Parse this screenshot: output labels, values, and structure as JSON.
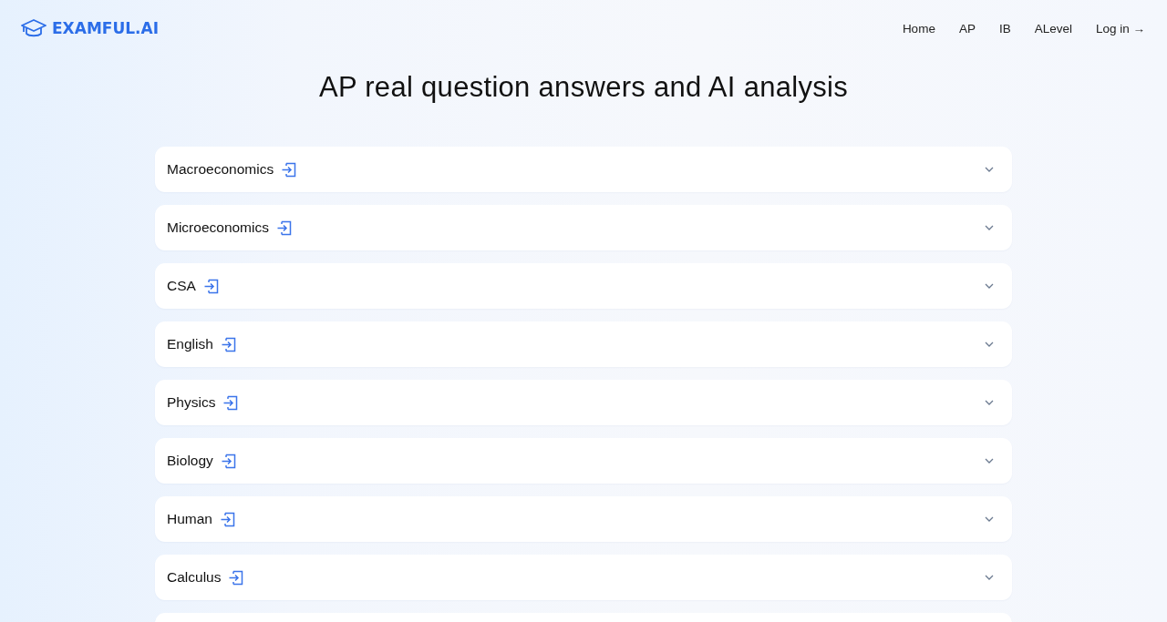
{
  "logo": {
    "text": "EXAMFUL.AI"
  },
  "nav": [
    "Home",
    "AP",
    "IB",
    "ALevel",
    "Log in →"
  ],
  "title": "AP real question answers and AI analysis",
  "subjects": [
    {
      "label": "Macroeconomics",
      "expanded": false
    },
    {
      "label": "Microeconomics",
      "expanded": false
    },
    {
      "label": "CSA",
      "expanded": false
    },
    {
      "label": "English",
      "expanded": false
    },
    {
      "label": "Physics",
      "expanded": false
    },
    {
      "label": "Biology",
      "expanded": false
    },
    {
      "label": "Human",
      "expanded": false
    },
    {
      "label": "Calculus",
      "expanded": false
    }
  ]
}
